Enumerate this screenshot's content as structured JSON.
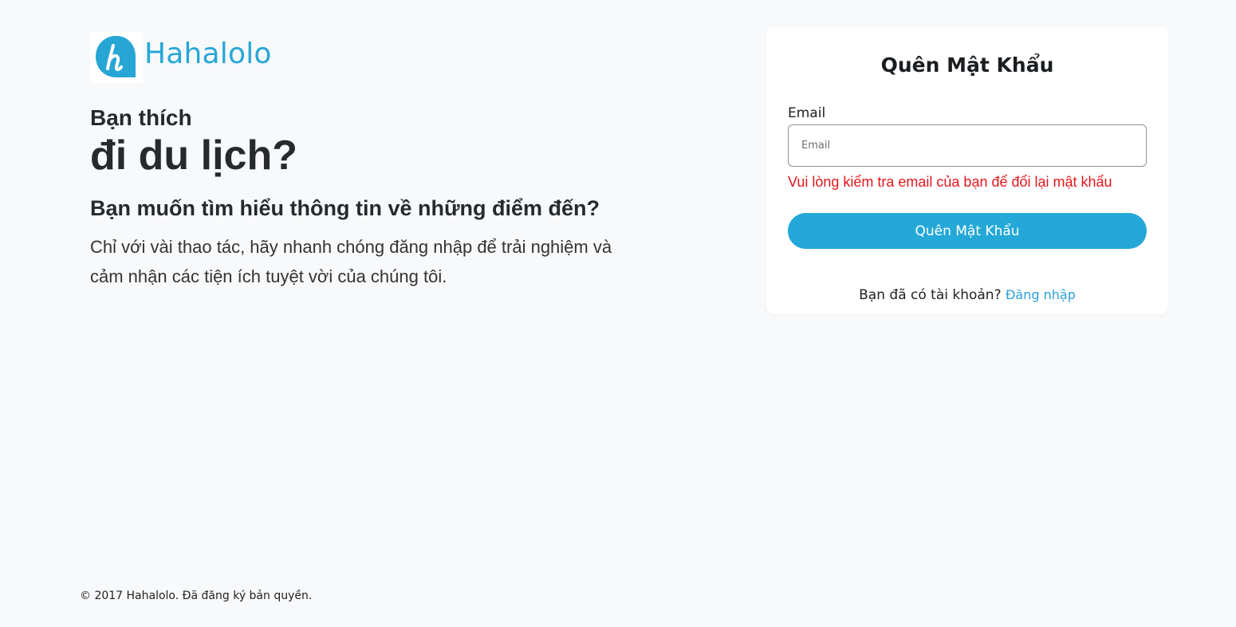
{
  "brand": {
    "name": "Hahalolo",
    "logo_icon": "hahalolo-h-logo-icon",
    "color": "#27a6d6"
  },
  "hero": {
    "kicker": "Bạn thích",
    "headline": "đi du lịch?",
    "subheading": "Bạn muốn tìm hiểu thông tin về những điểm đến?",
    "description": "Chỉ với vài thao tác, hãy nhanh chóng đăng nhập để trải nghiệm và cảm nhận các tiện ích tuyệt vời của chúng tôi."
  },
  "form": {
    "title": "Quên Mật Khẩu",
    "email_label": "Email",
    "email_value": "",
    "email_placeholder": "Email",
    "error_message": "Vui lòng kiểm tra email của bạn để đổi lại mật khẩu",
    "submit_label": "Quên Mật Khẩu",
    "have_account_text": "Bạn đã có tài khoản?",
    "login_link": "Đăng nhập",
    "accent_color": "#24a8d8",
    "error_color": "#e3171e"
  },
  "footer": {
    "copyright": "© 2017 Hahalolo. Đã đăng ký bản quyền."
  }
}
